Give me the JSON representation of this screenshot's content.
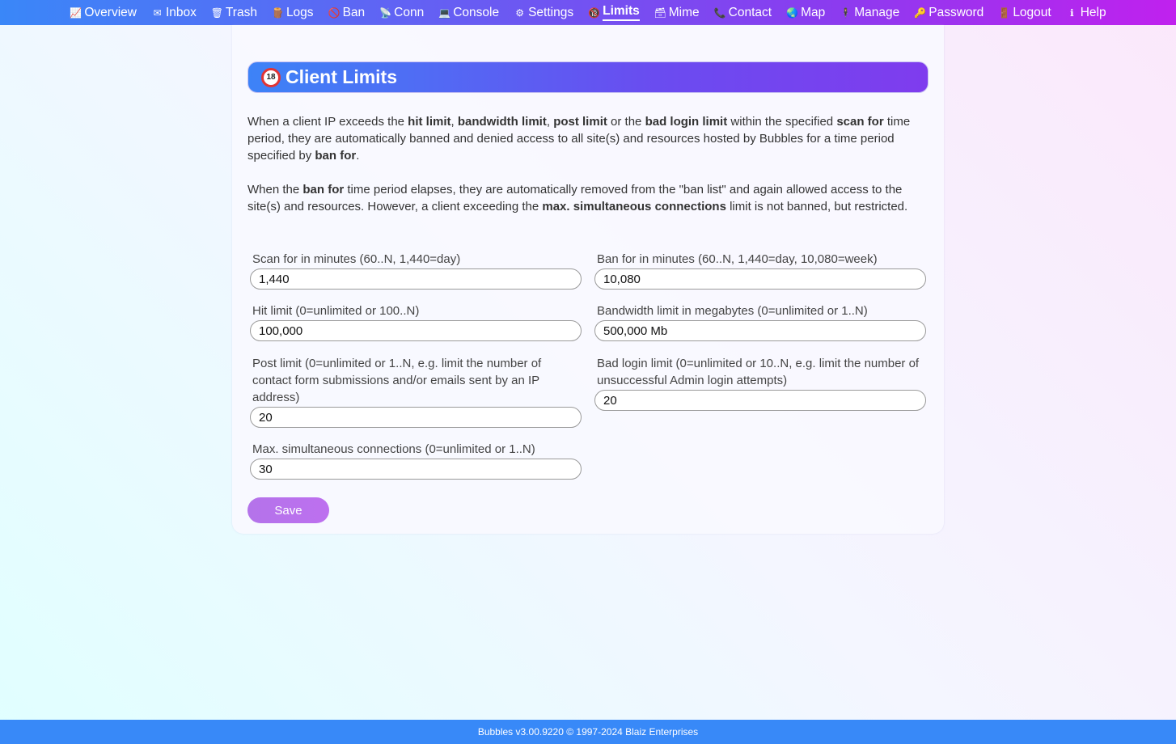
{
  "nav": {
    "items": [
      {
        "label": "Overview",
        "icon": "chart-icon",
        "glyph": "📈"
      },
      {
        "label": "Inbox",
        "icon": "envelope-icon",
        "glyph": "✉"
      },
      {
        "label": "Trash",
        "icon": "wastebasket-icon",
        "glyph": "🗑"
      },
      {
        "label": "Logs",
        "icon": "logs-icon",
        "glyph": "🪵"
      },
      {
        "label": "Ban",
        "icon": "prohibited-icon",
        "glyph": "🚫"
      },
      {
        "label": "Conn",
        "icon": "satellite-icon",
        "glyph": "📡"
      },
      {
        "label": "Console",
        "icon": "laptop-icon",
        "glyph": "💻"
      },
      {
        "label": "Settings",
        "icon": "gear-icon",
        "glyph": "⚙"
      },
      {
        "label": "Limits",
        "icon": "no-under-18-icon",
        "glyph": "🔞",
        "active": true
      },
      {
        "label": "Mime",
        "icon": "card-index-icon",
        "glyph": "🗃"
      },
      {
        "label": "Contact",
        "icon": "telephone-icon",
        "glyph": "📞"
      },
      {
        "label": "Map",
        "icon": "globe-icon",
        "glyph": "🌏"
      },
      {
        "label": "Manage",
        "icon": "person-icon",
        "glyph": "🕴"
      },
      {
        "label": "Password",
        "icon": "key-icon",
        "glyph": "🔑"
      },
      {
        "label": "Logout",
        "icon": "door-icon",
        "glyph": "🚪"
      },
      {
        "label": "Help",
        "icon": "info-icon",
        "glyph": "ℹ"
      }
    ]
  },
  "page": {
    "title": "Client Limits",
    "title_icon": "no-under-18-icon",
    "title_icon_text": "18"
  },
  "description": {
    "p1": [
      {
        "t": "When a client IP exceeds the ",
        "b": false
      },
      {
        "t": "hit limit",
        "b": true
      },
      {
        "t": ", ",
        "b": false
      },
      {
        "t": "bandwidth limit",
        "b": true
      },
      {
        "t": ", ",
        "b": false
      },
      {
        "t": "post limit",
        "b": true
      },
      {
        "t": " or the ",
        "b": false
      },
      {
        "t": "bad login limit",
        "b": true
      },
      {
        "t": " within the specified ",
        "b": false
      },
      {
        "t": "scan for",
        "b": true
      },
      {
        "t": " time period, they are automatically banned and denied access to all site(s) and resources hosted by Bubbles for a time period specified by ",
        "b": false
      },
      {
        "t": "ban for",
        "b": true
      },
      {
        "t": ".",
        "b": false
      }
    ],
    "p2": [
      {
        "t": "When the ",
        "b": false
      },
      {
        "t": "ban for",
        "b": true
      },
      {
        "t": " time period elapses, they are automatically removed from the \"ban list\" and again allowed access to the site(s) and resources. However, a client exceeding the ",
        "b": false
      },
      {
        "t": "max. simultaneous connections",
        "b": true
      },
      {
        "t": " limit is not banned, but restricted.",
        "b": false
      }
    ]
  },
  "form": {
    "scan_for": {
      "label": "Scan for in minutes (60..N, 1,440=day)",
      "value": "1,440"
    },
    "ban_for": {
      "label": "Ban for in minutes (60..N, 1,440=day, 10,080=week)",
      "value": "10,080"
    },
    "hit_limit": {
      "label": "Hit limit (0=unlimited or 100..N)",
      "value": "100,000"
    },
    "bandwidth_limit": {
      "label": "Bandwidth limit in megabytes (0=unlimited or 1..N)",
      "value": "500,000 Mb"
    },
    "post_limit": {
      "label": "Post limit (0=unlimited or 1..N, e.g. limit the number of contact form submissions and/or emails sent by an IP address)",
      "value": "20"
    },
    "bad_login_limit": {
      "label": "Bad login limit (0=unlimited or 10..N, e.g. limit the number of unsuccessful Admin login attempts)",
      "value": "20"
    },
    "max_connections": {
      "label": "Max. simultaneous connections (0=unlimited or 1..N)",
      "value": "30"
    },
    "save_label": "Save"
  },
  "footer": {
    "text": "Bubbles v3.00.9220 © 1997-2024 Blaiz Enterprises"
  },
  "colors": {
    "nav_start": "#3a87f8",
    "nav_end": "#c021ee",
    "title_start": "#3d83f7",
    "title_end": "#7f3cee",
    "save_button": "#b473ea",
    "footer": "#3889f8"
  }
}
